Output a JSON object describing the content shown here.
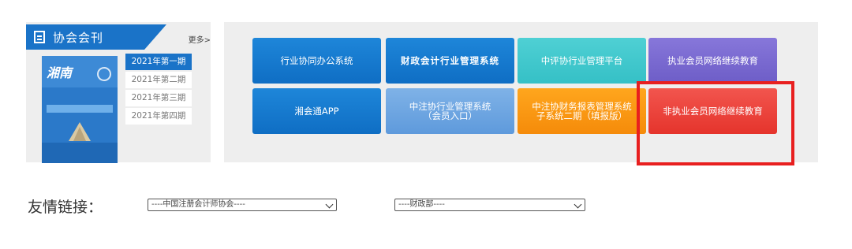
{
  "journal": {
    "title": "协会会刊",
    "more": "更多>",
    "issues": [
      "2021年第一期",
      "2021年第二期",
      "2021年第三期",
      "2021年第四期"
    ],
    "selected_issue": "2021年第一期",
    "cover_brand": "湘南"
  },
  "systems": {
    "row1": [
      "行业协同办公系统",
      "财政会计行业管理系统",
      "中评协行业管理平台",
      "执业会员网络继续教育"
    ],
    "row2": [
      "湘会通APP",
      "中注协行业管理系统\n（会员入口）",
      "中注协财务报表管理系统\n子系统二期（填报版）",
      "非执业会员网络继续教育"
    ]
  },
  "links": {
    "label": "友情链接：",
    "select1": "----中国注册会计师协会----",
    "select2": "----财政部----"
  },
  "colors": {
    "primary_blue": "#1a73c8",
    "highlight_red": "#e81f1f"
  }
}
